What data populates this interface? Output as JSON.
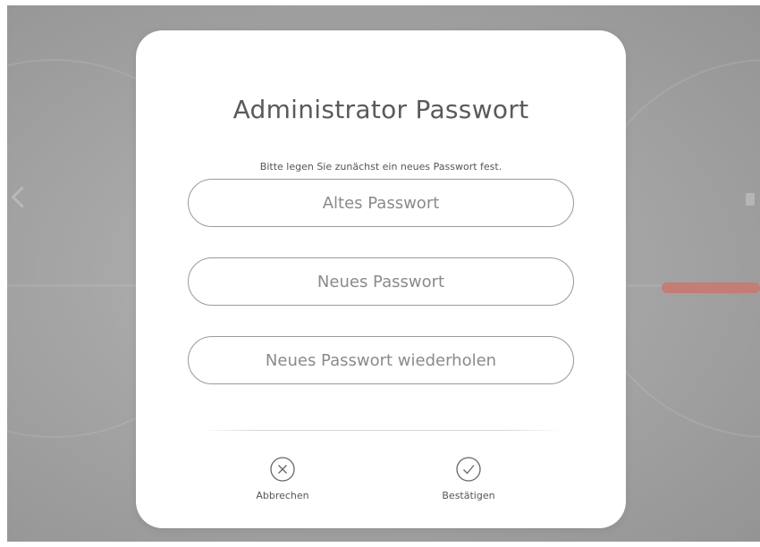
{
  "dialog": {
    "title": "Administrator Passwort",
    "subtitle": "Bitte legen Sie zunächst ein neues Passwort fest.",
    "fields": [
      {
        "placeholder": "Altes Passwort",
        "value": ""
      },
      {
        "placeholder": "Neues Passwort",
        "value": ""
      },
      {
        "placeholder": "Neues Passwort wiederholen",
        "value": ""
      }
    ],
    "actions": {
      "cancel": {
        "label": "Abbrechen",
        "icon": "close-circle-icon"
      },
      "confirm": {
        "label": "Bestätigen",
        "icon": "check-circle-icon"
      }
    }
  },
  "colors": {
    "dialog_bg": "#ffffff",
    "text": "#555555",
    "field_border": "#9a9a9a",
    "backdrop": "#a6a6a6",
    "accent": "#c8776f"
  }
}
